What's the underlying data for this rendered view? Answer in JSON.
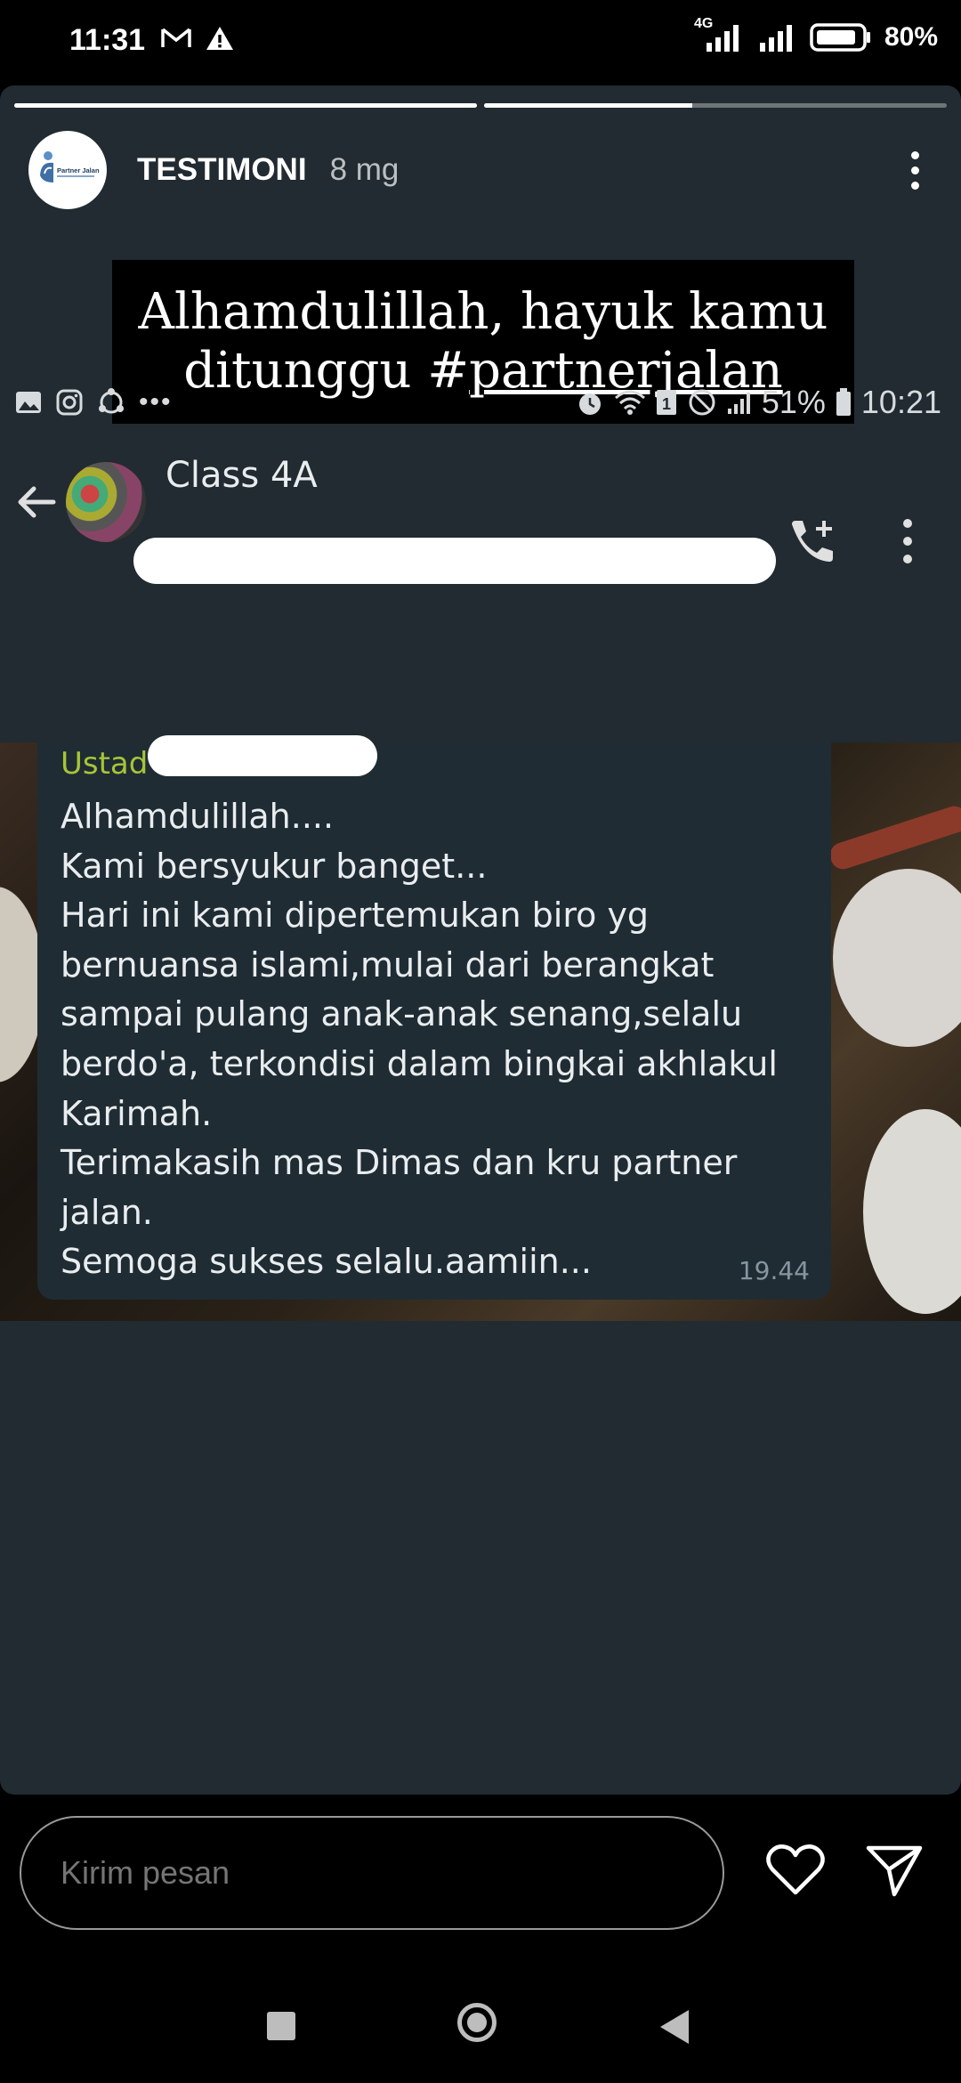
{
  "status_bar": {
    "time": "11:31",
    "network": "4G",
    "battery": "80%"
  },
  "story": {
    "progress": [
      1.0,
      0.45
    ],
    "account_name": "TESTIMONI",
    "post_age": "8 mg",
    "logo_text": "Partner Jalan",
    "caption": {
      "line1": "Alhamdulillah, hayuk kamu",
      "line2_prefix": "ditunggu #",
      "line2_tag": "partnerjalan"
    }
  },
  "embedded_screenshot": {
    "status_battery": "51%",
    "status_time": "10:21",
    "chat_title": "Class 4A",
    "sender_visible": "Ustad",
    "message_lines": [
      "Alhamdulillah....",
      "Kami bersyukur banget...",
      "Hari ini kami dipertemukan biro yg",
      "bernuansa islami,mulai dari berangkat",
      "sampai pulang anak-anak senang,selalu",
      "berdo'a, terkondisi dalam bingkai akhlakul",
      "Karimah.",
      "Terimakasih mas Dimas dan kru partner",
      "jalan.",
      "Semoga sukses selalu.aamiin..."
    ],
    "message_time": "19.44"
  },
  "reply": {
    "placeholder": "Kirim pesan"
  },
  "colors": {
    "story_bg": "#212b31",
    "bubble_bg": "#1f2c33",
    "sender_color": "#a4c639"
  }
}
